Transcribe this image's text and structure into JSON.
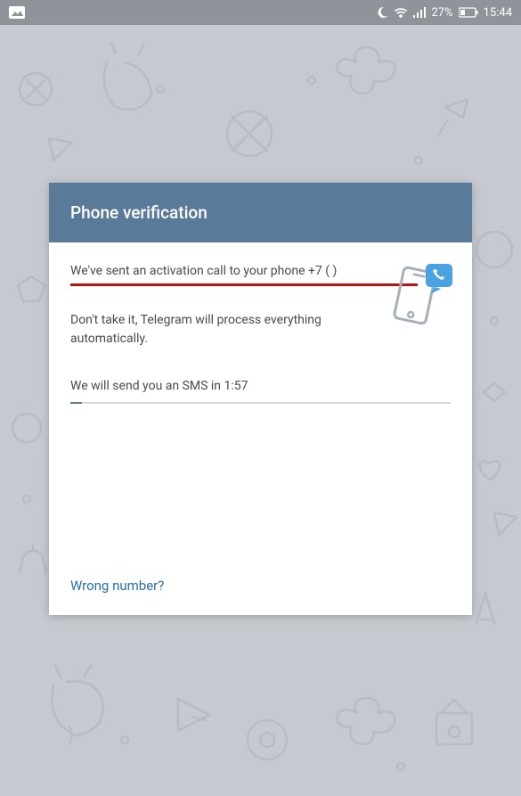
{
  "status": {
    "battery_pct": "27%",
    "time": "15:44"
  },
  "card": {
    "title": "Phone verification",
    "sent_msg": "We've sent an activation call to your phone +7 (        )",
    "dont_take_msg": "Don't take it, Telegram will process everything automatically.",
    "sms_countdown": "We will send you an SMS in 1:57",
    "wrong_number": "Wrong number?"
  }
}
